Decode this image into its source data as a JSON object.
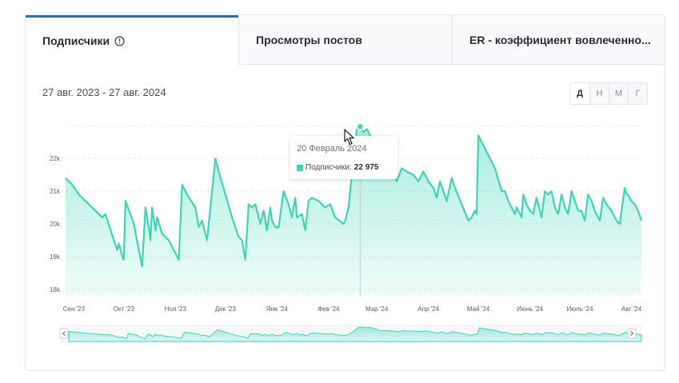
{
  "tabs": [
    {
      "label": "Подписчики",
      "active": true
    },
    {
      "label": "Просмотры постов",
      "active": false
    },
    {
      "label": "ER - коэффициент вовлеченно...",
      "active": false
    }
  ],
  "date_range": "27 авг. 2023 - 27 авг. 2024",
  "period_buttons": [
    {
      "label": "Д",
      "active": true
    },
    {
      "label": "Н",
      "active": false
    },
    {
      "label": "М",
      "active": false
    },
    {
      "label": "Г",
      "active": false
    }
  ],
  "tooltip": {
    "date": "20 Февраль 2024",
    "series_label": "Подписчики:",
    "value": "22 975"
  },
  "colors": {
    "accent": "#1f6fd0",
    "line": "#3dd6b5",
    "area": "#bdf2e3"
  },
  "chart_data": {
    "type": "area",
    "series_name": "Подписчики",
    "y_ticks": [
      "18k",
      "19k",
      "20k",
      "21k",
      "22k"
    ],
    "ylim": [
      17800,
      23300
    ],
    "x_ticks": [
      "Сен '23",
      "Окт '23",
      "Ноя '23",
      "Дек '23",
      "Янв '24",
      "Фев '24",
      "Мар '24",
      "Апр '24",
      "Май '24",
      "Июнь '24",
      "Июль '24",
      "Авг '24"
    ],
    "x_tick_days": [
      5,
      35,
      66,
      96,
      127,
      158,
      187,
      218,
      248,
      279,
      309,
      340
    ],
    "grid": true,
    "highlight": {
      "day": 177,
      "value": 22975
    },
    "points": [
      [
        0,
        21400
      ],
      [
        4,
        21200
      ],
      [
        8,
        20900
      ],
      [
        14,
        20600
      ],
      [
        20,
        20300
      ],
      [
        22,
        20200
      ],
      [
        24,
        20300
      ],
      [
        29,
        19500
      ],
      [
        31,
        19200
      ],
      [
        32,
        19400
      ],
      [
        34,
        19000
      ],
      [
        35,
        18900
      ],
      [
        36,
        20700
      ],
      [
        41,
        20000
      ],
      [
        44,
        19200
      ],
      [
        46,
        18700
      ],
      [
        48,
        20500
      ],
      [
        50,
        19900
      ],
      [
        51,
        19500
      ],
      [
        52,
        20500
      ],
      [
        54,
        19800
      ],
      [
        55,
        20200
      ],
      [
        58,
        19700
      ],
      [
        62,
        19500
      ],
      [
        64,
        19300
      ],
      [
        66,
        19100
      ],
      [
        68,
        18900
      ],
      [
        70,
        21200
      ],
      [
        73,
        20900
      ],
      [
        78,
        20500
      ],
      [
        80,
        19900
      ],
      [
        82,
        20100
      ],
      [
        85,
        19500
      ],
      [
        90,
        22000
      ],
      [
        92,
        21600
      ],
      [
        96,
        20900
      ],
      [
        100,
        20200
      ],
      [
        104,
        19600
      ],
      [
        106,
        19500
      ],
      [
        108,
        18900
      ],
      [
        110,
        20600
      ],
      [
        112,
        20500
      ],
      [
        114,
        20600
      ],
      [
        117,
        20000
      ],
      [
        119,
        20400
      ],
      [
        121,
        19800
      ],
      [
        123,
        20500
      ],
      [
        124,
        20100
      ],
      [
        126,
        19900
      ],
      [
        128,
        19900
      ],
      [
        131,
        21000
      ],
      [
        134,
        20600
      ],
      [
        136,
        20200
      ],
      [
        138,
        20800
      ],
      [
        139,
        20200
      ],
      [
        142,
        20300
      ],
      [
        144,
        19800
      ],
      [
        146,
        20700
      ],
      [
        148,
        20800
      ],
      [
        152,
        20700
      ],
      [
        156,
        20500
      ],
      [
        159,
        20600
      ],
      [
        162,
        20200
      ],
      [
        167,
        20000
      ],
      [
        168,
        20100
      ],
      [
        170,
        20500
      ],
      [
        171,
        21000
      ],
      [
        175,
        22900
      ],
      [
        177,
        22975
      ],
      [
        179,
        22800
      ],
      [
        181,
        22900
      ],
      [
        185,
        22500
      ],
      [
        188,
        21600
      ],
      [
        190,
        21800
      ],
      [
        193,
        21700
      ],
      [
        196,
        21600
      ],
      [
        199,
        21300
      ],
      [
        202,
        21700
      ],
      [
        205,
        21600
      ],
      [
        209,
        21500
      ],
      [
        212,
        21300
      ],
      [
        215,
        21600
      ],
      [
        218,
        21300
      ],
      [
        221,
        21100
      ],
      [
        223,
        20800
      ],
      [
        225,
        21300
      ],
      [
        227,
        21000
      ],
      [
        229,
        20700
      ],
      [
        232,
        21400
      ],
      [
        234,
        21100
      ],
      [
        238,
        20600
      ],
      [
        242,
        20100
      ],
      [
        244,
        20200
      ],
      [
        246,
        20400
      ],
      [
        247,
        20300
      ],
      [
        248,
        22700
      ],
      [
        251,
        22400
      ],
      [
        254,
        22100
      ],
      [
        258,
        21700
      ],
      [
        262,
        21000
      ],
      [
        264,
        21000
      ],
      [
        266,
        20700
      ],
      [
        270,
        20300
      ],
      [
        271,
        20500
      ],
      [
        274,
        20200
      ],
      [
        275,
        20900
      ],
      [
        277,
        20600
      ],
      [
        279,
        20400
      ],
      [
        281,
        20300
      ],
      [
        283,
        20800
      ],
      [
        285,
        20400
      ],
      [
        286,
        20200
      ],
      [
        288,
        21000
      ],
      [
        290,
        20900
      ],
      [
        292,
        21000
      ],
      [
        294,
        20500
      ],
      [
        296,
        20300
      ],
      [
        298,
        20900
      ],
      [
        300,
        20500
      ],
      [
        302,
        20300
      ],
      [
        304,
        21000
      ],
      [
        306,
        20700
      ],
      [
        308,
        20400
      ],
      [
        310,
        20400
      ],
      [
        312,
        20100
      ],
      [
        314,
        20900
      ],
      [
        316,
        20700
      ],
      [
        318,
        20400
      ],
      [
        319,
        20300
      ],
      [
        321,
        20100
      ],
      [
        323,
        20800
      ],
      [
        325,
        20600
      ],
      [
        328,
        20400
      ],
      [
        330,
        20200
      ],
      [
        331,
        20100
      ],
      [
        333,
        20000
      ],
      [
        336,
        21100
      ],
      [
        337,
        20900
      ],
      [
        338,
        20900
      ],
      [
        340,
        20700
      ],
      [
        342,
        20600
      ],
      [
        344,
        20400
      ],
      [
        346,
        20100
      ]
    ]
  }
}
